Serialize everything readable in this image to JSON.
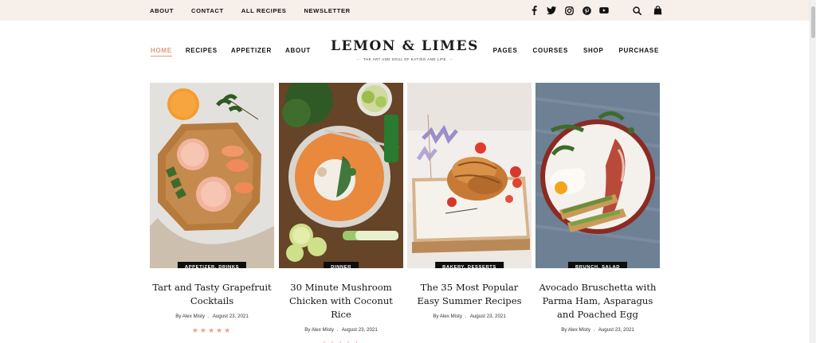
{
  "topbar": {
    "links": [
      "ABOUT",
      "CONTACT",
      "ALL RECIPES",
      "NEWSLETTER"
    ],
    "social_icons": [
      "facebook-icon",
      "twitter-icon",
      "instagram-icon",
      "pinterest-icon",
      "youtube-icon"
    ],
    "tool_icons": [
      "search-icon",
      "shopping-bag-icon"
    ]
  },
  "nav": {
    "left": [
      "HOME",
      "RECIPES",
      "APPETIZER",
      "ABOUT"
    ],
    "right": [
      "PAGES",
      "COURSES",
      "SHOP",
      "PURCHASE"
    ],
    "active": "HOME"
  },
  "brand": {
    "name": "LEMON & LIMES",
    "tagline": "THE ART AND SOUL OF EATING AND LIFE"
  },
  "posts": [
    {
      "category": "APPETIZER, DRINKS",
      "title": "Tart and Tasty Grapefruit Cocktails",
      "author": "By Alex Misty",
      "date": "August 23, 2021",
      "stars": "★★★★★"
    },
    {
      "category": "DINNER",
      "title": "30 Minute Mushroom Chicken with Coconut Rice",
      "author": "By Alex Misty",
      "date": "August 23, 2021",
      "stars": "★★★★★"
    },
    {
      "category": "BAKERY, DESSERTS",
      "title": "The 35 Most Popular Easy Summer Recipes",
      "author": "By Alex Misty",
      "date": "August 23, 2021",
      "stars": ""
    },
    {
      "category": "BRUNCH, SALAD",
      "title": "Avocado Bruschetta with Parma Ham, Asparagus and Poached Egg",
      "author": "By Alex Misty",
      "date": "August 23, 2021",
      "stars": ""
    }
  ],
  "colors": {
    "accent": "#e09a78",
    "topbar_bg": "#f6efea",
    "badge_bg": "#0d0d0d",
    "stars": "#e8a487"
  }
}
